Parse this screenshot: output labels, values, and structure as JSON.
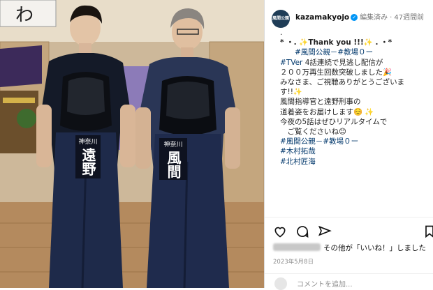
{
  "post": {
    "username": "kazamakyojo",
    "verified_mark": "✓",
    "edited": "編集済み",
    "time_ago": "47週間前",
    "avatar_text": "風間公親"
  },
  "caption": {
    "lines": [
      {
        "text": ".",
        "kind": "plain"
      },
      {
        "text": "* ・. ✨Thank you !!!✨ . ・*",
        "kind": "bold"
      },
      {
        "text": "",
        "kind": "plain"
      },
      {
        "text": "　　#風間公親－#教場０ー",
        "kind": "tag"
      },
      {
        "text": "#TVer 4話連続で見逃し配信が",
        "kind": "mixed"
      },
      {
        "text": "２００万再生回数突破しました🎉",
        "kind": "plain"
      },
      {
        "text": "",
        "kind": "plain"
      },
      {
        "text": "みなさま、ご視聴ありがとうございま",
        "kind": "plain"
      },
      {
        "text": "す!!✨",
        "kind": "plain"
      },
      {
        "text": "",
        "kind": "plain"
      },
      {
        "text": "風間指導官と遠野刑事の",
        "kind": "plain"
      },
      {
        "text": "道着姿をお届けします☺️ ✨",
        "kind": "plain"
      },
      {
        "text": "",
        "kind": "plain"
      },
      {
        "text": "今夜の5話はぜひリアルタイムで",
        "kind": "plain"
      },
      {
        "text": "　ご覧くださいね😊",
        "kind": "plain"
      },
      {
        "text": "",
        "kind": "plain"
      },
      {
        "text": "#風間公親－#教場０ー",
        "kind": "tag"
      },
      {
        "text": "#木村拓哉",
        "kind": "tag"
      },
      {
        "text": "#北村匠海",
        "kind": "tag"
      }
    ]
  },
  "photo": {
    "left_name_tag": [
      "神奈川",
      "遠野"
    ],
    "right_name_tag": [
      "神奈川",
      "風間"
    ],
    "banner_text": "わ"
  },
  "actions": {
    "like_icon": "heart-icon",
    "comment_icon": "comment-icon",
    "share_icon": "share-icon",
    "likes_text": "その他が「いいね！」しました",
    "date": "2023年5月8日",
    "comment_placeholder": "コメントを追加..."
  },
  "colors": {
    "hakama": "#1e2a4a",
    "floor": "#b48a5e",
    "wall": "#d8c4a4",
    "link": "#00376b",
    "verified": "#0095f6"
  }
}
